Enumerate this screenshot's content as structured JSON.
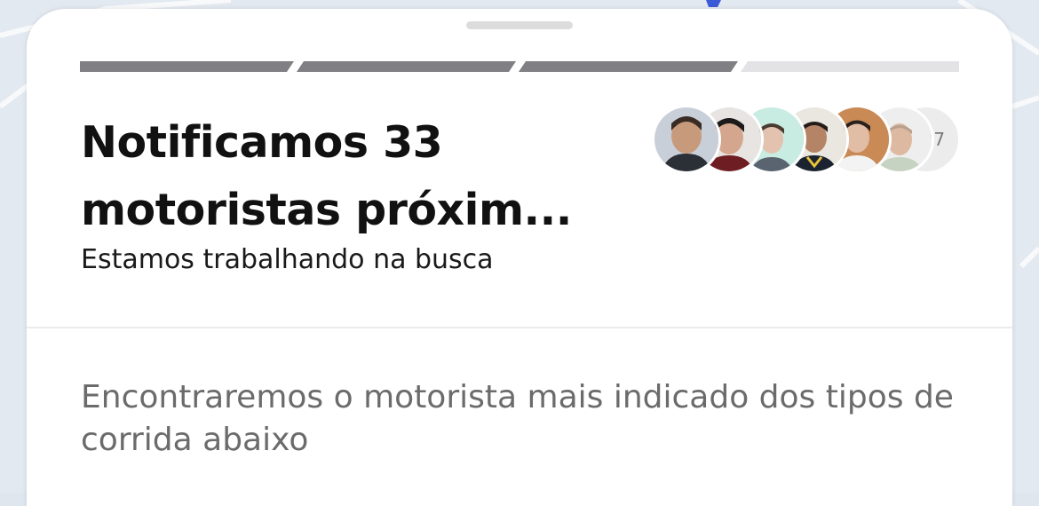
{
  "sheet": {
    "progress": {
      "segments": 4,
      "completed": 3,
      "fill_color": "#7f7f84",
      "empty_color": "#e3e3e6"
    },
    "title": "Notificamos 33\nmotoristas próxim...",
    "subtitle": "Estamos trabalhando na busca",
    "drivers": {
      "avatar_icons": [
        "driver-photo-icon",
        "driver-photo-icon",
        "driver-photo-icon",
        "driver-photo-icon",
        "driver-photo-icon",
        "driver-photo-icon"
      ],
      "more_count": "+27"
    },
    "info": "Encontraremos o motorista mais indicado dos tipos de corrida abaixo"
  }
}
